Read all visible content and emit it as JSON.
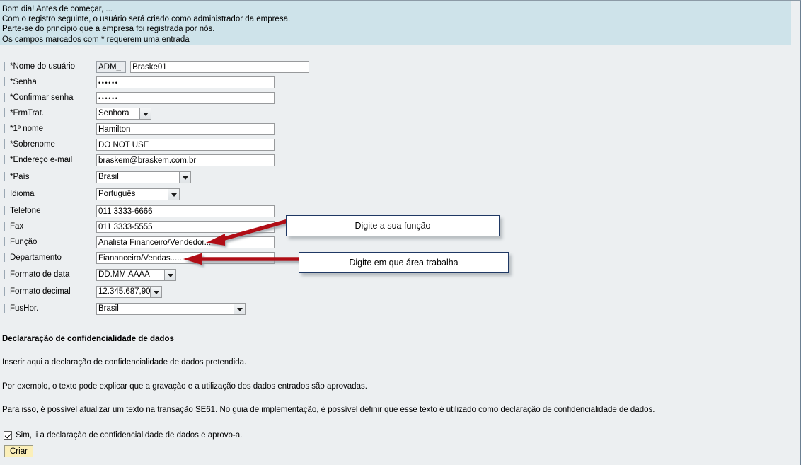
{
  "banner": {
    "lines": [
      "Bom dia! Antes de começar, ...",
      "Com o registro seguinte, o usuário será criado como administrador da empresa.",
      "Parte-se do princípio que a empresa foi registrada por nós.",
      "Os campos marcados com * requerem uma entrada"
    ]
  },
  "form": {
    "fields": [
      {
        "label": "*Nome do usuário",
        "type": "text-prefixed",
        "prefix": "ADM_",
        "value": "Braske01"
      },
      {
        "label": "*Senha",
        "type": "password",
        "value": "••••••"
      },
      {
        "label": "*Confirmar senha",
        "type": "password",
        "value": "••••••"
      },
      {
        "label": "*FrmTrat.",
        "type": "select",
        "value": "Senhora"
      },
      {
        "label": "*1º nome",
        "type": "text",
        "value": "Hamilton"
      },
      {
        "label": "*Sobrenome",
        "type": "text",
        "value": "DO NOT USE"
      },
      {
        "label": "*Endereço e-mail",
        "type": "text",
        "value": "braskem@braskem.com.br"
      },
      {
        "label": "*País",
        "type": "select",
        "value": "Brasil"
      },
      {
        "label": "Idioma",
        "type": "select",
        "value": "Português"
      },
      {
        "label": "Telefone",
        "type": "text",
        "value": "011 3333-6666"
      },
      {
        "label": "Fax",
        "type": "text",
        "value": "011 3333-5555"
      },
      {
        "label": "Função",
        "type": "text",
        "value": "Analista Financeiro/Vendedor..."
      },
      {
        "label": "Departamento",
        "type": "text",
        "value": "Fiananceiro/Vendas....."
      },
      {
        "label": "Formato de data",
        "type": "select",
        "value": "DD.MM.AAAA"
      },
      {
        "label": "Formato decimal",
        "type": "select",
        "value": "12.345.687,90"
      },
      {
        "label": "FusHor.",
        "type": "select",
        "value": "Brasil"
      }
    ]
  },
  "callouts": [
    {
      "text": "Digite a sua função"
    },
    {
      "text": "Digite em que área trabalha"
    }
  ],
  "declaration": {
    "title": "Declararação de confidencialidade de dados",
    "paragraphs": [
      "Inserir aqui a declaração de confidencialidade de dados pretendida.",
      "Por exemplo, o texto pode explicar que a gravação e a utilização dos dados entrados são aprovadas.",
      "Para isso, é possível atualizar um texto na transação SE61. No guia de implementação, é possível definir que esse texto é utilizado como declaração de confidencialidade de dados."
    ],
    "consent_label": "Sim, li a declaração de confidencialidade de dados e aprovo-a.",
    "submit_label": "Criar"
  },
  "colors": {
    "banner_bg": "#cee3ea",
    "page_bg": "#eceff1",
    "callout_border": "#1f3864",
    "arrow": "#b01116",
    "button_bg": "#fbefb9"
  }
}
